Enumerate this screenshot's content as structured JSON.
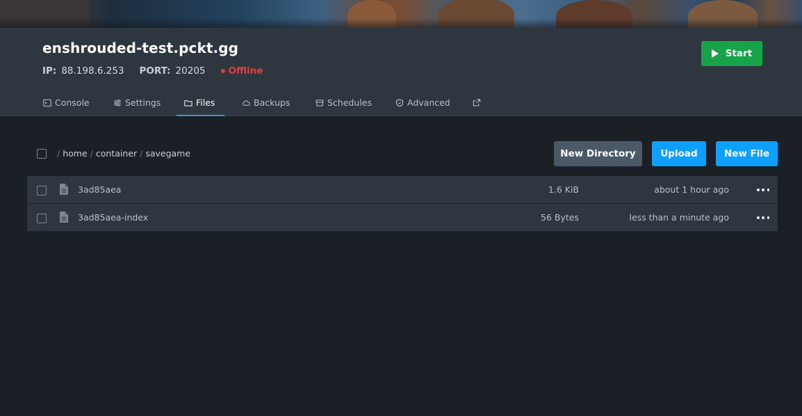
{
  "server": {
    "name": "enshrouded-test.pckt.gg",
    "ip_label": "IP:",
    "ip": "88.198.6.253",
    "port_label": "PORT:",
    "port": "20205",
    "status": "Offline",
    "status_color": "#e53e3e",
    "start_label": "Start"
  },
  "tabs": [
    {
      "label": "Console",
      "icon": "terminal-icon"
    },
    {
      "label": "Settings",
      "icon": "sliders-icon"
    },
    {
      "label": "Files",
      "icon": "folder-icon",
      "active": true
    },
    {
      "label": "Backups",
      "icon": "cloud-icon"
    },
    {
      "label": "Schedules",
      "icon": "archive-icon"
    },
    {
      "label": "Advanced",
      "icon": "shield-icon"
    }
  ],
  "external_link_icon": "external-link-icon",
  "breadcrumb": {
    "root": "/",
    "segments": [
      "home",
      "container",
      "savegame"
    ]
  },
  "actions": {
    "new_directory": "New Directory",
    "upload": "Upload",
    "new_file": "New File"
  },
  "files": [
    {
      "name": "3ad85aea",
      "size": "1.6 KiB",
      "modified": "about 1 hour ago"
    },
    {
      "name": "3ad85aea-index",
      "size": "56 Bytes",
      "modified": "less than a minute ago"
    }
  ],
  "colors": {
    "accent_blue": "#0ea0ff",
    "start_green": "#17a34a",
    "tab_underline": "#3b95e8"
  }
}
